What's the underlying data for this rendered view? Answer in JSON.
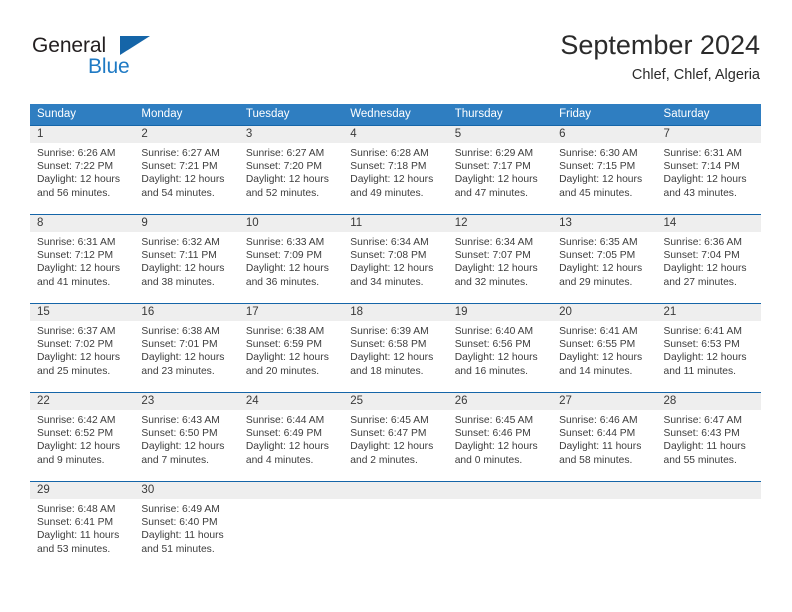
{
  "brand": {
    "name_primary": "General",
    "name_secondary": "Blue",
    "logo_icon": "triangle-logo-icon"
  },
  "header": {
    "title": "September 2024",
    "subtitle": "Chlef, Chlef, Algeria"
  },
  "calendar": {
    "weekday_headers": [
      "Sunday",
      "Monday",
      "Tuesday",
      "Wednesday",
      "Thursday",
      "Friday",
      "Saturday"
    ],
    "labels": {
      "sunrise": "Sunrise:",
      "sunset": "Sunset:",
      "daylight": "Daylight:"
    },
    "accent_color": "#2f7ec1",
    "separator_color": "#1565a8",
    "daynum_band_color": "#eeeeee",
    "weeks": [
      [
        {
          "day": "1",
          "sunrise": "Sunrise: 6:26 AM",
          "sunset": "Sunset: 7:22 PM",
          "daylight_line1": "Daylight: 12 hours",
          "daylight_line2": "and 56 minutes."
        },
        {
          "day": "2",
          "sunrise": "Sunrise: 6:27 AM",
          "sunset": "Sunset: 7:21 PM",
          "daylight_line1": "Daylight: 12 hours",
          "daylight_line2": "and 54 minutes."
        },
        {
          "day": "3",
          "sunrise": "Sunrise: 6:27 AM",
          "sunset": "Sunset: 7:20 PM",
          "daylight_line1": "Daylight: 12 hours",
          "daylight_line2": "and 52 minutes."
        },
        {
          "day": "4",
          "sunrise": "Sunrise: 6:28 AM",
          "sunset": "Sunset: 7:18 PM",
          "daylight_line1": "Daylight: 12 hours",
          "daylight_line2": "and 49 minutes."
        },
        {
          "day": "5",
          "sunrise": "Sunrise: 6:29 AM",
          "sunset": "Sunset: 7:17 PM",
          "daylight_line1": "Daylight: 12 hours",
          "daylight_line2": "and 47 minutes."
        },
        {
          "day": "6",
          "sunrise": "Sunrise: 6:30 AM",
          "sunset": "Sunset: 7:15 PM",
          "daylight_line1": "Daylight: 12 hours",
          "daylight_line2": "and 45 minutes."
        },
        {
          "day": "7",
          "sunrise": "Sunrise: 6:31 AM",
          "sunset": "Sunset: 7:14 PM",
          "daylight_line1": "Daylight: 12 hours",
          "daylight_line2": "and 43 minutes."
        }
      ],
      [
        {
          "day": "8",
          "sunrise": "Sunrise: 6:31 AM",
          "sunset": "Sunset: 7:12 PM",
          "daylight_line1": "Daylight: 12 hours",
          "daylight_line2": "and 41 minutes."
        },
        {
          "day": "9",
          "sunrise": "Sunrise: 6:32 AM",
          "sunset": "Sunset: 7:11 PM",
          "daylight_line1": "Daylight: 12 hours",
          "daylight_line2": "and 38 minutes."
        },
        {
          "day": "10",
          "sunrise": "Sunrise: 6:33 AM",
          "sunset": "Sunset: 7:09 PM",
          "daylight_line1": "Daylight: 12 hours",
          "daylight_line2": "and 36 minutes."
        },
        {
          "day": "11",
          "sunrise": "Sunrise: 6:34 AM",
          "sunset": "Sunset: 7:08 PM",
          "daylight_line1": "Daylight: 12 hours",
          "daylight_line2": "and 34 minutes."
        },
        {
          "day": "12",
          "sunrise": "Sunrise: 6:34 AM",
          "sunset": "Sunset: 7:07 PM",
          "daylight_line1": "Daylight: 12 hours",
          "daylight_line2": "and 32 minutes."
        },
        {
          "day": "13",
          "sunrise": "Sunrise: 6:35 AM",
          "sunset": "Sunset: 7:05 PM",
          "daylight_line1": "Daylight: 12 hours",
          "daylight_line2": "and 29 minutes."
        },
        {
          "day": "14",
          "sunrise": "Sunrise: 6:36 AM",
          "sunset": "Sunset: 7:04 PM",
          "daylight_line1": "Daylight: 12 hours",
          "daylight_line2": "and 27 minutes."
        }
      ],
      [
        {
          "day": "15",
          "sunrise": "Sunrise: 6:37 AM",
          "sunset": "Sunset: 7:02 PM",
          "daylight_line1": "Daylight: 12 hours",
          "daylight_line2": "and 25 minutes."
        },
        {
          "day": "16",
          "sunrise": "Sunrise: 6:38 AM",
          "sunset": "Sunset: 7:01 PM",
          "daylight_line1": "Daylight: 12 hours",
          "daylight_line2": "and 23 minutes."
        },
        {
          "day": "17",
          "sunrise": "Sunrise: 6:38 AM",
          "sunset": "Sunset: 6:59 PM",
          "daylight_line1": "Daylight: 12 hours",
          "daylight_line2": "and 20 minutes."
        },
        {
          "day": "18",
          "sunrise": "Sunrise: 6:39 AM",
          "sunset": "Sunset: 6:58 PM",
          "daylight_line1": "Daylight: 12 hours",
          "daylight_line2": "and 18 minutes."
        },
        {
          "day": "19",
          "sunrise": "Sunrise: 6:40 AM",
          "sunset": "Sunset: 6:56 PM",
          "daylight_line1": "Daylight: 12 hours",
          "daylight_line2": "and 16 minutes."
        },
        {
          "day": "20",
          "sunrise": "Sunrise: 6:41 AM",
          "sunset": "Sunset: 6:55 PM",
          "daylight_line1": "Daylight: 12 hours",
          "daylight_line2": "and 14 minutes."
        },
        {
          "day": "21",
          "sunrise": "Sunrise: 6:41 AM",
          "sunset": "Sunset: 6:53 PM",
          "daylight_line1": "Daylight: 12 hours",
          "daylight_line2": "and 11 minutes."
        }
      ],
      [
        {
          "day": "22",
          "sunrise": "Sunrise: 6:42 AM",
          "sunset": "Sunset: 6:52 PM",
          "daylight_line1": "Daylight: 12 hours",
          "daylight_line2": "and 9 minutes."
        },
        {
          "day": "23",
          "sunrise": "Sunrise: 6:43 AM",
          "sunset": "Sunset: 6:50 PM",
          "daylight_line1": "Daylight: 12 hours",
          "daylight_line2": "and 7 minutes."
        },
        {
          "day": "24",
          "sunrise": "Sunrise: 6:44 AM",
          "sunset": "Sunset: 6:49 PM",
          "daylight_line1": "Daylight: 12 hours",
          "daylight_line2": "and 4 minutes."
        },
        {
          "day": "25",
          "sunrise": "Sunrise: 6:45 AM",
          "sunset": "Sunset: 6:47 PM",
          "daylight_line1": "Daylight: 12 hours",
          "daylight_line2": "and 2 minutes."
        },
        {
          "day": "26",
          "sunrise": "Sunrise: 6:45 AM",
          "sunset": "Sunset: 6:46 PM",
          "daylight_line1": "Daylight: 12 hours",
          "daylight_line2": "and 0 minutes."
        },
        {
          "day": "27",
          "sunrise": "Sunrise: 6:46 AM",
          "sunset": "Sunset: 6:44 PM",
          "daylight_line1": "Daylight: 11 hours",
          "daylight_line2": "and 58 minutes."
        },
        {
          "day": "28",
          "sunrise": "Sunrise: 6:47 AM",
          "sunset": "Sunset: 6:43 PM",
          "daylight_line1": "Daylight: 11 hours",
          "daylight_line2": "and 55 minutes."
        }
      ],
      [
        {
          "day": "29",
          "sunrise": "Sunrise: 6:48 AM",
          "sunset": "Sunset: 6:41 PM",
          "daylight_line1": "Daylight: 11 hours",
          "daylight_line2": "and 53 minutes."
        },
        {
          "day": "30",
          "sunrise": "Sunrise: 6:49 AM",
          "sunset": "Sunset: 6:40 PM",
          "daylight_line1": "Daylight: 11 hours",
          "daylight_line2": "and 51 minutes."
        },
        {
          "day": "",
          "sunrise": "",
          "sunset": "",
          "daylight_line1": "",
          "daylight_line2": ""
        },
        {
          "day": "",
          "sunrise": "",
          "sunset": "",
          "daylight_line1": "",
          "daylight_line2": ""
        },
        {
          "day": "",
          "sunrise": "",
          "sunset": "",
          "daylight_line1": "",
          "daylight_line2": ""
        },
        {
          "day": "",
          "sunrise": "",
          "sunset": "",
          "daylight_line1": "",
          "daylight_line2": ""
        },
        {
          "day": "",
          "sunrise": "",
          "sunset": "",
          "daylight_line1": "",
          "daylight_line2": ""
        }
      ]
    ]
  }
}
